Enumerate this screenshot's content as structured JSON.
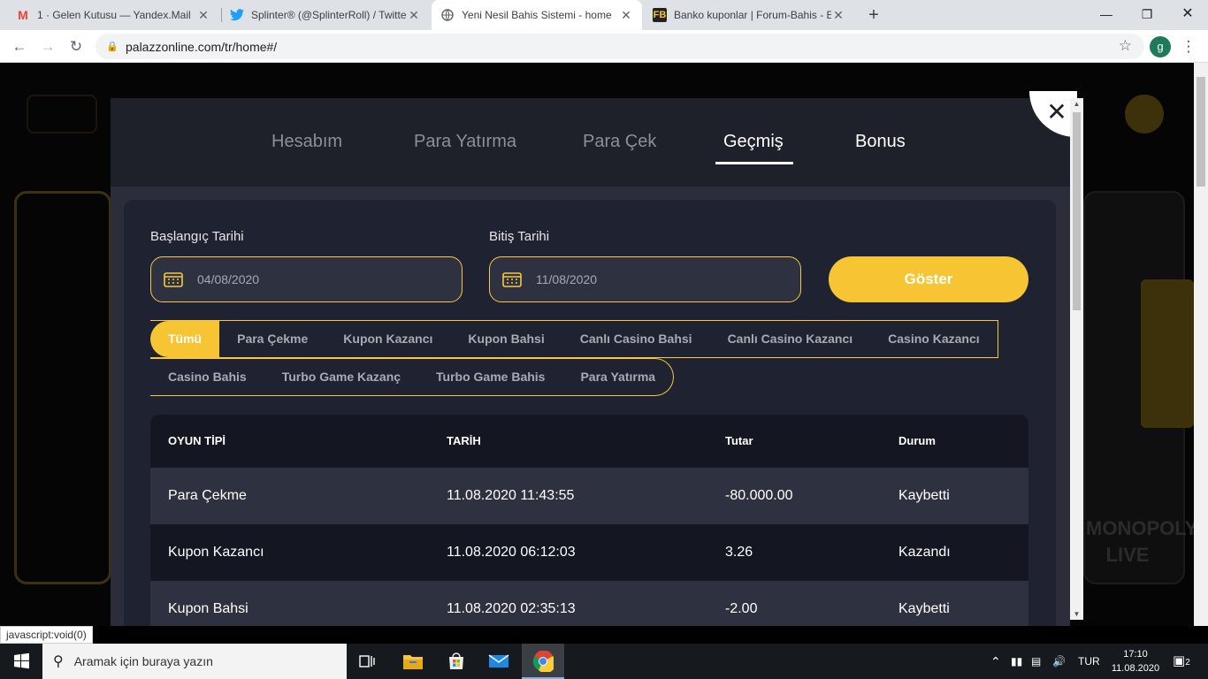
{
  "browser": {
    "tabs": [
      {
        "title": "1 · Gelen Kutusu — Yandex.Mail",
        "icon": "gmail-icon"
      },
      {
        "title": "Splinter® (@SplinterRoll) / Twitte",
        "icon": "twitter-icon"
      },
      {
        "title": "Yeni Nesil Bahis Sistemi - home",
        "icon": "globe-icon"
      },
      {
        "title": "Banko kuponlar | Forum-Bahis - E",
        "icon": "forum-icon"
      }
    ],
    "url": "palazzonline.com/tr/home#/",
    "profile_initial": "g",
    "status_tip": "javascript:void(0)"
  },
  "modal": {
    "nav": [
      "Hesabım",
      "Para Yatırma",
      "Para Çek",
      "Geçmiş",
      "Bonus"
    ],
    "active_nav": "Geçmiş",
    "close_symbol": "✕",
    "start_label": "Başlangıç Tarihi",
    "end_label": "Bitiş Tarihi",
    "start_date": "04/08/2020",
    "end_date": "11/08/2020",
    "show_button": "Göster",
    "filters_row1": [
      "Tümü",
      "Para Çekme",
      "Kupon Kazancı",
      "Kupon Bahsi",
      "Canlı Casino Bahsi",
      "Canlı Casino Kazancı",
      "Casino Kazancı"
    ],
    "filters_row2": [
      "Casino Bahis",
      "Turbo Game Kazanç",
      "Turbo Game Bahis",
      "Para Yatırma"
    ],
    "table": {
      "headers": [
        "OYUN TİPİ",
        "TARİH",
        "Tutar",
        "Durum"
      ],
      "rows": [
        [
          "Para Çekme",
          "11.08.2020 11:43:55",
          "-80.000.00",
          "Kaybetti"
        ],
        [
          "Kupon Kazancı",
          "11.08.2020 06:12:03",
          "3.26",
          "Kazandı"
        ],
        [
          "Kupon Bahsi",
          "11.08.2020 02:35:13",
          "-2.00",
          "Kaybetti"
        ]
      ]
    },
    "colors": {
      "accent": "#f7c533",
      "panel": "#1f2230",
      "header": "#1e202a"
    }
  },
  "background": {
    "monopoly_text": "MONOPOLY",
    "live_text": "LIVE"
  },
  "taskbar": {
    "search_placeholder": "Aramak için buraya yazın",
    "lang": "TUR",
    "time": "17:10",
    "date": "11.08.2020",
    "notifications": "2"
  }
}
